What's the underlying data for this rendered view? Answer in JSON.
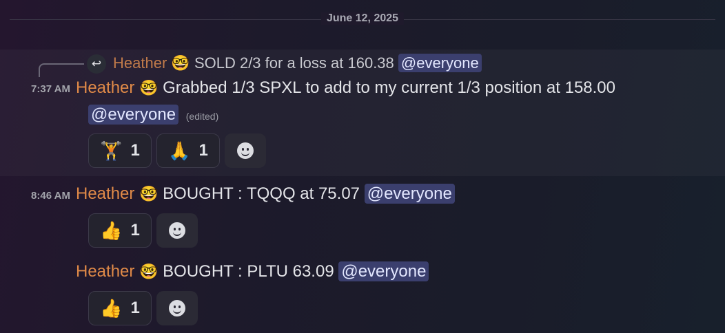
{
  "date_divider": "June 12, 2025",
  "reply": {
    "icon": "reply-arrow-icon",
    "author": "Heather",
    "author_emoji": "🤓",
    "text": "SOLD 2/3 for a loss at 160.38",
    "mention": "@everyone"
  },
  "messages": [
    {
      "time": "7:37 AM",
      "author": "Heather",
      "author_emoji": "🤓",
      "text": "Grabbed 1/3 SPXL to add to my current 1/3 position at 158.00",
      "mention": "@everyone",
      "edited": "(edited)",
      "reactions": [
        {
          "emoji": "🏋️",
          "name": "weightlifter-icon",
          "count": "1"
        },
        {
          "emoji": "🙏",
          "name": "folded-hands-icon",
          "count": "1"
        }
      ]
    },
    {
      "time": "8:46 AM",
      "author": "Heather",
      "author_emoji": "🤓",
      "text": "BOUGHT : TQQQ at 75.07",
      "mention": "@everyone",
      "reactions": [
        {
          "emoji": "👍",
          "name": "thumbs-up-icon",
          "count": "1"
        }
      ]
    },
    {
      "author": "Heather",
      "author_emoji": "🤓",
      "text": "BOUGHT : PLTU 63.09",
      "mention": "@everyone",
      "reactions": [
        {
          "emoji": "👍",
          "name": "thumbs-up-icon",
          "count": "1"
        }
      ]
    }
  ],
  "add_reaction_icon": "add-reaction-icon"
}
